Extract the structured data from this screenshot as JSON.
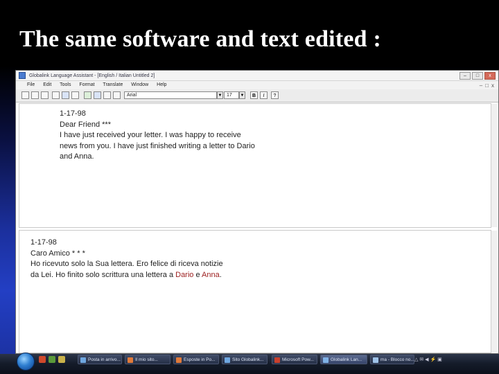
{
  "slide": {
    "title": "The same software and text edited :"
  },
  "window": {
    "title": "Globalink Language Assistant - [English / Italian Untitled 2]",
    "controls": {
      "minimize": "–",
      "maximize": "□",
      "close": "x"
    }
  },
  "menu": {
    "items": [
      "File",
      "Edit",
      "Tools",
      "Format",
      "Translate",
      "Window",
      "Help"
    ],
    "mdi_controls": {
      "minimize": "–",
      "restore": "□",
      "close": "x"
    }
  },
  "toolbar": {
    "font_name": "Arial",
    "font_size": "17",
    "bold_label": "B",
    "italic_label": "I",
    "help_label": "?",
    "dropdown_glyph": "▼"
  },
  "source_pane": {
    "lines": [
      "1-17-98",
      "Dear Friend ***",
      "I have just received your letter. I was happy to receive",
      "news from you. I have just finished writing a letter to Dario",
      "and Anna."
    ]
  },
  "target_pane": {
    "date": "1-17-98",
    "greeting": "Caro Amico * * *",
    "line3": "Ho ricevuto solo la Sua lettera. Ero felice di riceva notizie",
    "line4_start": "da Lei. Ho finito solo scrittura una lettera a ",
    "name1": "Dario",
    "conj": " e ",
    "name2": "Anna",
    "end": ".",
    "highlight_color": "#9b1c1c"
  },
  "taskbar": {
    "buttons": [
      "Posta in arrivo...",
      "Il mio sito...",
      "Esposte in Po...",
      "Sito Globalink...",
      "Microsoft Pow...",
      "Globalink Lan...",
      "ma - Blocco no..."
    ],
    "tray_time": "△ ✉ ◀ ⚡ ▣"
  }
}
